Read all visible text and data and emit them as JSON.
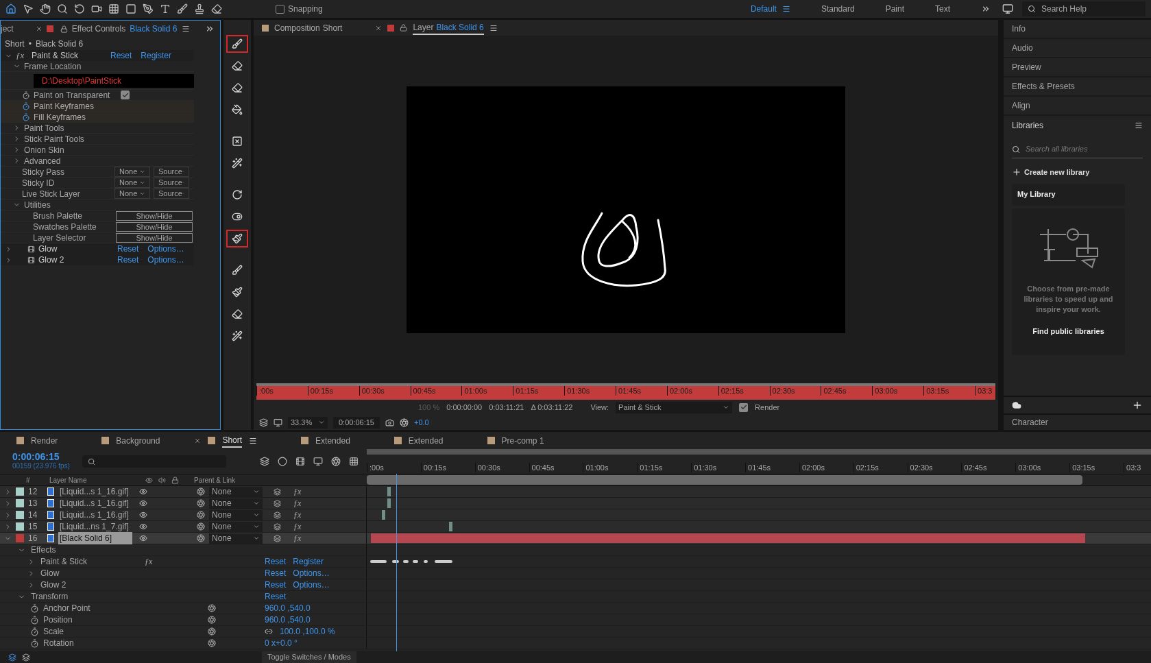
{
  "toolbar": {
    "tools": [
      {
        "selected": true
      },
      {
        "selected": false
      },
      {
        "selected": false
      },
      {
        "selected": false
      },
      {
        "selected": false
      },
      {
        "selected": false
      },
      {
        "selected": false
      },
      {
        "selected": false
      },
      {
        "selected": false
      },
      {
        "selected": false
      },
      {
        "selected": false
      },
      {
        "selected": false
      },
      {
        "selected": false
      }
    ],
    "snapping": {
      "label": "Snapping",
      "checked": false
    },
    "workspaces": [
      {
        "label": "Default",
        "selected": true
      },
      {
        "label": "Standard",
        "selected": false
      },
      {
        "label": "Paint",
        "selected": false
      },
      {
        "label": "Text",
        "selected": false
      }
    ],
    "search": {
      "placeholder": "Search Help"
    }
  },
  "effect_controls": {
    "project_tab": "ject",
    "title": "Effect Controls",
    "layer": "Black Solid 6",
    "breadcrumb": [
      "Short",
      "Black Solid 6"
    ],
    "breadcrumb_separator": "•",
    "effects": [
      {
        "name": "Paint & Stick",
        "badge": "ƒx",
        "expanded": true,
        "links": [
          "Reset",
          "Register"
        ],
        "children": [
          {
            "kind": "group",
            "label": "Frame Location",
            "expanded": true,
            "children": [
              {
                "kind": "path",
                "value": "D:\\Desktop\\PaintStick"
              }
            ]
          },
          {
            "kind": "checkbox",
            "label": "Paint on Transparent",
            "checked": true
          },
          {
            "kind": "keyframe",
            "label": "Paint Keyframes"
          },
          {
            "kind": "keyframe",
            "label": "Fill Keyframes"
          },
          {
            "kind": "group",
            "label": "Paint Tools",
            "expanded": false
          },
          {
            "kind": "group",
            "label": "Stick Paint Tools",
            "expanded": false
          },
          {
            "kind": "group",
            "label": "Onion Skin",
            "expanded": false
          },
          {
            "kind": "group",
            "label": "Advanced",
            "expanded": false
          },
          {
            "kind": "dropdowns",
            "label": "Sticky Pass",
            "values": [
              "None",
              "Source"
            ]
          },
          {
            "kind": "dropdowns",
            "label": "Sticky ID",
            "values": [
              "None",
              "Source"
            ]
          },
          {
            "kind": "dropdowns",
            "label": "Live Stick Layer",
            "values": [
              "None",
              "Source"
            ]
          },
          {
            "kind": "group",
            "label": "Utilities",
            "expanded": true,
            "children": [
              {
                "kind": "button",
                "label": "Brush Palette",
                "button": "Show/Hide"
              },
              {
                "kind": "button",
                "label": "Swatches Palette",
                "button": "Show/Hide"
              },
              {
                "kind": "button",
                "label": "Layer Selector",
                "button": "Show/Hide"
              }
            ]
          }
        ]
      },
      {
        "name": "Glow",
        "expanded": false,
        "links": [
          "Reset",
          "Options…"
        ]
      },
      {
        "name": "Glow 2",
        "expanded": false,
        "links": [
          "Reset",
          "Options…"
        ]
      }
    ]
  },
  "paint_tools": [
    {
      "selected": true
    },
    {
      "selected": false
    },
    {
      "selected": false
    },
    {
      "selected": false
    },
    {
      "selected": false
    },
    {
      "selected": false
    },
    {
      "selected": false
    },
    {
      "selected": false
    },
    {
      "selected": true
    },
    {
      "selected": false
    },
    {
      "selected": false
    },
    {
      "selected": false
    },
    {
      "selected": false
    }
  ],
  "viewer": {
    "tabs": [
      {
        "label": "Composition",
        "name": "Short",
        "selected": false
      },
      {
        "label": "Layer",
        "name": "Black Solid 6",
        "selected": true
      }
    ],
    "ruler": [
      ":00s",
      "00:15s",
      "00:30s",
      "00:45s",
      "01:00s",
      "01:15s",
      "01:30s",
      "01:45s",
      "02:00s",
      "02:15s",
      "02:30s",
      "02:45s",
      "03:00s",
      "03:15s",
      "03:3"
    ],
    "opacity": "100 %",
    "in_point": "0:00:00:00",
    "out_point": "0:03:11:21",
    "duration": "Δ 0:03:11:22",
    "view_label": "View:",
    "view": "Paint & Stick",
    "render": {
      "label": "Render",
      "checked": true
    },
    "zoom": "33.3%",
    "timecode": "0:00:06:15",
    "exposure": "+0.0"
  },
  "right_panel": {
    "items": [
      "Info",
      "Audio",
      "Preview",
      "Effects & Presets",
      "Align"
    ],
    "libraries": {
      "title": "Libraries",
      "search_placeholder": "Search all libraries",
      "create": "Create new library",
      "library": "My Library",
      "message": "Choose from pre-made libraries to speed up and inspire your work.",
      "link": "Find public libraries"
    },
    "footer_item": "Character"
  },
  "timeline": {
    "tabs": [
      {
        "label": "Render",
        "selected": false
      },
      {
        "label": "Background",
        "selected": false
      },
      {
        "label": "Short",
        "selected": true
      },
      {
        "label": "Extended",
        "selected": false
      },
      {
        "label": "Extended",
        "selected": false
      },
      {
        "label": "Pre-comp 1",
        "selected": false
      }
    ],
    "timecode": "0:00:06:15",
    "frame_info": "00159 (23.976 fps)",
    "columns": [
      "#",
      "Layer Name",
      "Parent & Link"
    ],
    "ruler": [
      ":00s",
      "00:15s",
      "00:30s",
      "00:45s",
      "01:00s",
      "01:15s",
      "01:30s",
      "01:45s",
      "02:00s",
      "02:15s",
      "02:30s",
      "02:45s",
      "03:00s",
      "03:15s",
      "03:3"
    ],
    "layers": [
      {
        "number": "12",
        "name": "[Liquid...s 1_16.gif]",
        "color": "#a6d0c8",
        "selected": false,
        "expanded": false,
        "parent": "None",
        "switch": "ƒx"
      },
      {
        "number": "13",
        "name": "[Liquid...s 1_16.gif]",
        "color": "#a6d0c8",
        "selected": false,
        "expanded": false,
        "parent": "None",
        "switch": "ƒx"
      },
      {
        "number": "14",
        "name": "[Liquid...s 1_16.gif]",
        "color": "#a6d0c8",
        "selected": false,
        "expanded": false,
        "parent": "None",
        "switch": "ƒx"
      },
      {
        "number": "15",
        "name": "[Liquid...ns 1_7.gif]",
        "color": "#a6d0c8",
        "selected": false,
        "expanded": false,
        "parent": "None",
        "switch": "ƒx"
      },
      {
        "number": "16",
        "name": "[Black Solid 6]",
        "color": "#c03a3a",
        "selected": true,
        "expanded": true,
        "parent": "None",
        "switch": "ƒx",
        "children": [
          {
            "kind": "group",
            "label": "Effects",
            "expanded": true,
            "children": [
              {
                "kind": "effect",
                "label": "Paint & Stick",
                "badge": "ƒx",
                "links": [
                  "Reset",
                  "Register"
                ]
              },
              {
                "kind": "effect",
                "label": "Glow",
                "links": [
                  "Reset",
                  "Options…"
                ]
              },
              {
                "kind": "effect",
                "label": "Glow 2",
                "links": [
                  "Reset",
                  "Options…"
                ]
              }
            ]
          },
          {
            "kind": "group",
            "label": "Transform",
            "expanded": true,
            "links": [
              "Reset"
            ],
            "children": [
              {
                "kind": "property",
                "label": "Anchor Point",
                "value": "960.0 ,540.0"
              },
              {
                "kind": "property",
                "label": "Position",
                "value": "960.0 ,540.0"
              },
              {
                "kind": "property",
                "label": "Scale",
                "value": "100.0 ,100.0 %",
                "linked": true
              },
              {
                "kind": "property",
                "label": "Rotation",
                "value": "0 x+0.0 °"
              }
            ]
          }
        ]
      }
    ],
    "footer": "Toggle Switches / Modes"
  }
}
